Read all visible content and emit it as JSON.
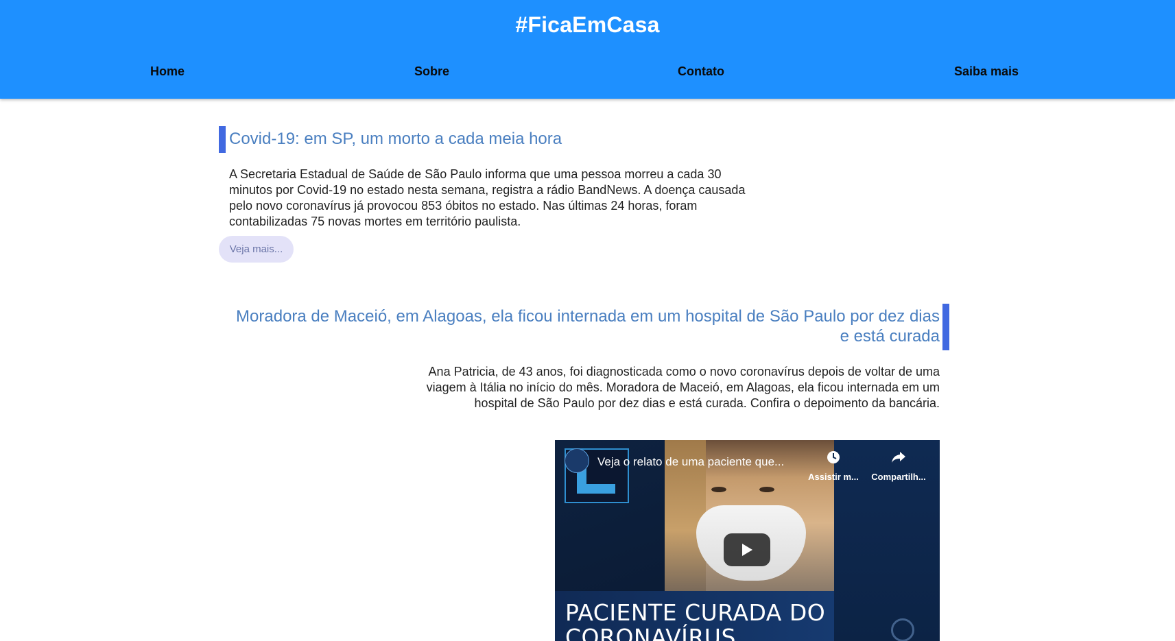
{
  "header": {
    "title": "#FicaEmCasa",
    "nav": [
      {
        "label": "Home"
      },
      {
        "label": "Sobre"
      },
      {
        "label": "Contato"
      },
      {
        "label": "Saiba mais"
      }
    ]
  },
  "articles": [
    {
      "title": "Covid-19: em SP, um morto a cada meia hora",
      "text": "A Secretaria Estadual de Saúde de São Paulo informa que uma pessoa morreu a cada 30 minutos por Covid-19 no estado nesta semana, registra a rádio BandNews. A doença causada pelo novo coronavírus já provocou 853 óbitos no estado. Nas últimas 24 horas, foram contabilizadas 75 novas mortes em território paulista.",
      "button_label": "Veja mais..."
    },
    {
      "title": "Moradora de Maceió, em Alagoas, ela ficou internada em um hospital de São Paulo por dez dias e está curada",
      "text": "Ana Patricia, de 43 anos, foi diagnosticada como o novo coronavírus depois de voltar de uma viagem à Itália no início do mês. Moradora de Maceió, em Alagoas, ela ficou internada em um hospital de São Paulo por dez dias e está curada. Confira o depoimento da bancária."
    }
  ],
  "video": {
    "title": "Veja o relato de uma paciente que...",
    "watch_later_label": "Assistir m...",
    "share_label": "Compartilh...",
    "caption": "PACIENTE CURADA DO CORONAVÍRUS",
    "icons": {
      "watch_later": "clock-icon",
      "share": "share-arrow-icon",
      "play": "play-icon"
    }
  },
  "colors": {
    "header_bg": "#1e90ff",
    "accent_bar": "#4169e1",
    "title_text": "#4a7fc0",
    "button_bg": "#e3e2f8"
  }
}
